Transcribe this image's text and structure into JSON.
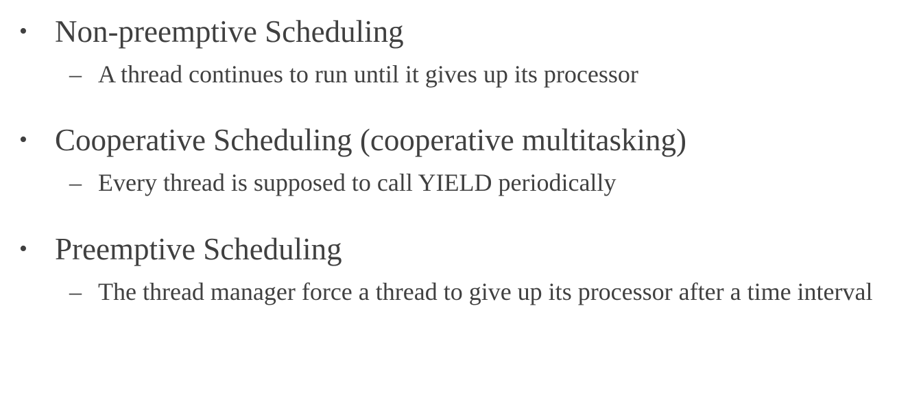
{
  "bullets": [
    {
      "heading": "Non-preemptive Scheduling",
      "sub": "A thread continues to run until it gives up its processor"
    },
    {
      "heading": "Cooperative Scheduling (cooperative multitasking)",
      "sub": "Every thread is supposed to call YIELD periodically"
    },
    {
      "heading": "Preemptive Scheduling",
      "sub": "The thread manager force a thread to give up its processor after a time interval"
    }
  ],
  "markers": {
    "level1": "•",
    "level2": "–"
  },
  "colors": {
    "text": "#404040",
    "background": "#ffffff"
  }
}
